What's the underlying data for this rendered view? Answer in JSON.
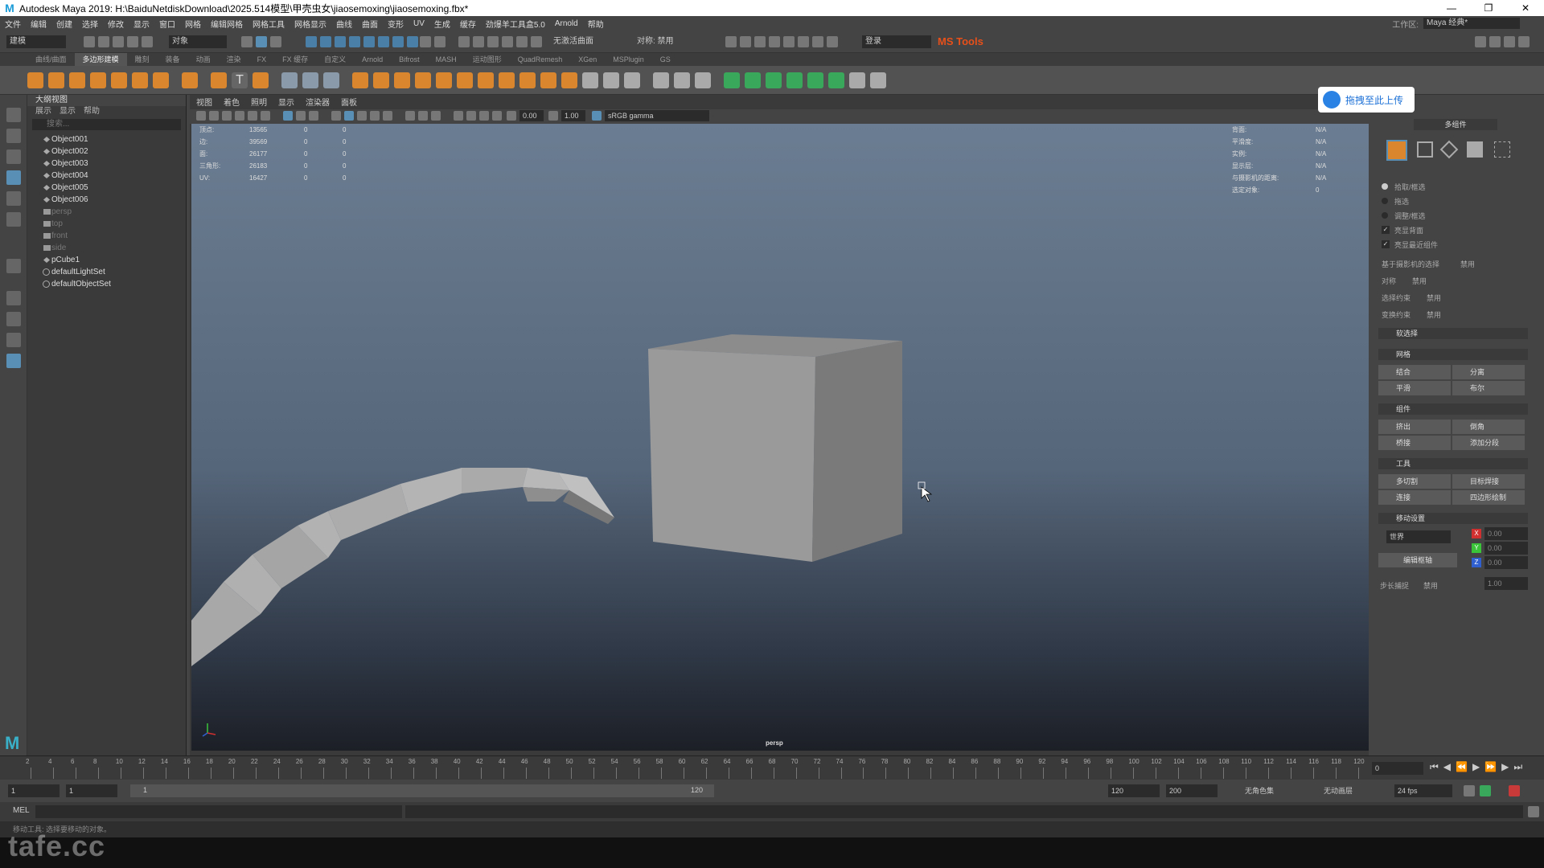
{
  "window": {
    "title": "Autodesk Maya 2019: H:\\BaiduNetdiskDownload\\2025.514模型\\甲壳虫女\\jiaosemoxing\\jiaosemoxing.fbx*",
    "controls": [
      "—",
      "❐",
      "✕"
    ]
  },
  "menubar": {
    "items": [
      "文件",
      "编辑",
      "创建",
      "选择",
      "修改",
      "显示",
      "窗口",
      "网格",
      "编辑网格",
      "网格工具",
      "网格显示",
      "曲线",
      "曲面",
      "变形",
      "UV",
      "生成",
      "缓存",
      "劲爆羊工具盒5.0",
      "Arnold",
      "帮助"
    ],
    "workspace_label": "工作区:",
    "workspace_value": "Maya 经典*"
  },
  "statusline": {
    "mode": "建模",
    "objects": "对象",
    "no_live": "无激活曲面",
    "symmetry": "对称: 禁用",
    "login": "登录",
    "mstools": "MS Tools"
  },
  "shelftabs": [
    "曲线/曲面",
    "多边形建模",
    "雕刻",
    "装备",
    "动画",
    "渲染",
    "FX",
    "FX 缓存",
    "自定义",
    "Arnold",
    "Bifrost",
    "MASH",
    "运动图形",
    "QuadRemesh",
    "XGen",
    "MSPlugin",
    "GS"
  ],
  "shelf_active_tab": "多边形建模",
  "outliner": {
    "title": "大纲视图",
    "menu": [
      "展示",
      "显示",
      "帮助"
    ],
    "search_placeholder": "搜索...",
    "items": [
      {
        "label": "Object001",
        "kind": "mesh",
        "dim": false
      },
      {
        "label": "Object002",
        "kind": "mesh",
        "dim": false
      },
      {
        "label": "Object003",
        "kind": "mesh",
        "dim": false
      },
      {
        "label": "Object004",
        "kind": "mesh",
        "dim": false
      },
      {
        "label": "Object005",
        "kind": "mesh",
        "dim": false
      },
      {
        "label": "Object006",
        "kind": "mesh",
        "dim": false
      },
      {
        "label": "persp",
        "kind": "camera",
        "dim": true
      },
      {
        "label": "top",
        "kind": "camera",
        "dim": true
      },
      {
        "label": "front",
        "kind": "camera",
        "dim": true
      },
      {
        "label": "side",
        "kind": "camera",
        "dim": true
      },
      {
        "label": "pCube1",
        "kind": "mesh",
        "dim": false
      },
      {
        "label": "defaultLightSet",
        "kind": "set",
        "dim": false
      },
      {
        "label": "defaultObjectSet",
        "kind": "set",
        "dim": false
      }
    ]
  },
  "viewport": {
    "menu": [
      "视图",
      "着色",
      "照明",
      "显示",
      "渲染器",
      "面板"
    ],
    "exposure": "0.00",
    "gamma": "1.00",
    "colorspace": "sRGB gamma",
    "camera_label": "persp",
    "hud_left": [
      {
        "label": "顶点:",
        "v1": "13565",
        "v2": "0",
        "v3": "0"
      },
      {
        "label": "边:",
        "v1": "39569",
        "v2": "0",
        "v3": "0"
      },
      {
        "label": "面:",
        "v1": "26177",
        "v2": "0",
        "v3": "0"
      },
      {
        "label": "三角形:",
        "v1": "26183",
        "v2": "0",
        "v3": "0"
      },
      {
        "label": "UV:",
        "v1": "16427",
        "v2": "0",
        "v3": "0"
      }
    ],
    "hud_right": [
      {
        "label": "背面:",
        "value": "N/A"
      },
      {
        "label": "平滑度:",
        "value": "N/A"
      },
      {
        "label": "实例:",
        "value": "N/A"
      },
      {
        "label": "显示层:",
        "value": "N/A"
      },
      {
        "label": "与摄影机的距离:",
        "value": "N/A"
      },
      {
        "label": "选定对象:",
        "value": "0"
      }
    ]
  },
  "upload_button": "拖拽至此上传",
  "modeling_toolkit": {
    "header": "多组件",
    "radio": [
      "拾取/框选",
      "拖选",
      "调整/框选"
    ],
    "checks": [
      "亮显背面",
      "亮显最近组件"
    ],
    "camera_select": "基于摄影机的选择",
    "camera_select_value": "禁用",
    "symmetry": "对称",
    "symmetry_value": "禁用",
    "select_constraint": "选择约束",
    "select_constraint_value": "禁用",
    "transform_constraint": "变换约束",
    "transform_constraint_value": "禁用",
    "soft_select": "软选择",
    "sec_mesh": "网格",
    "combine": "结合",
    "separate": "分离",
    "smooth": "平滑",
    "boolean": "布尔",
    "sec_components": "组件",
    "extrude": "挤出",
    "bevel": "倒角",
    "bridge": "桥接",
    "add_divisions": "添加分段",
    "sec_tools": "工具",
    "multicut": "多切割",
    "target_weld": "目标焊接",
    "connect": "连接",
    "quad_draw": "四边形绘制",
    "sec_move": "移动设置",
    "world": "世界",
    "edit_pivot": "编辑枢轴",
    "step_snap": "步长捕捉",
    "step_snap_value": "禁用",
    "x_val": "0.00",
    "y_val": "0.00",
    "z_val": "0.00",
    "step_val": "1.00"
  },
  "timeline": {
    "ticks": [
      "2",
      "4",
      "6",
      "8",
      "10",
      "12",
      "14",
      "16",
      "18",
      "20",
      "22",
      "24",
      "26",
      "28",
      "30",
      "32",
      "34",
      "36",
      "38",
      "40",
      "42",
      "44",
      "46",
      "48",
      "50",
      "52",
      "54",
      "56",
      "58",
      "60",
      "62",
      "64",
      "66",
      "68",
      "70",
      "72",
      "74",
      "76",
      "78",
      "80",
      "82",
      "84",
      "86",
      "88",
      "90",
      "92",
      "94",
      "96",
      "98",
      "100",
      "102",
      "104",
      "106",
      "108",
      "110",
      "112",
      "114",
      "116",
      "118",
      "120"
    ],
    "current_frame": "0"
  },
  "rangebar": {
    "start": "1",
    "start2": "1",
    "slider_start": "1",
    "slider_end": "120",
    "end": "120",
    "end2": "200",
    "char_set": "无角色集",
    "anim_layer": "无动画层",
    "fps": "24 fps"
  },
  "cmdline": {
    "label": "MEL"
  },
  "helpline": {
    "text": "移动工具: 选择要移动的对象。"
  },
  "watermark": "tafe.cc"
}
